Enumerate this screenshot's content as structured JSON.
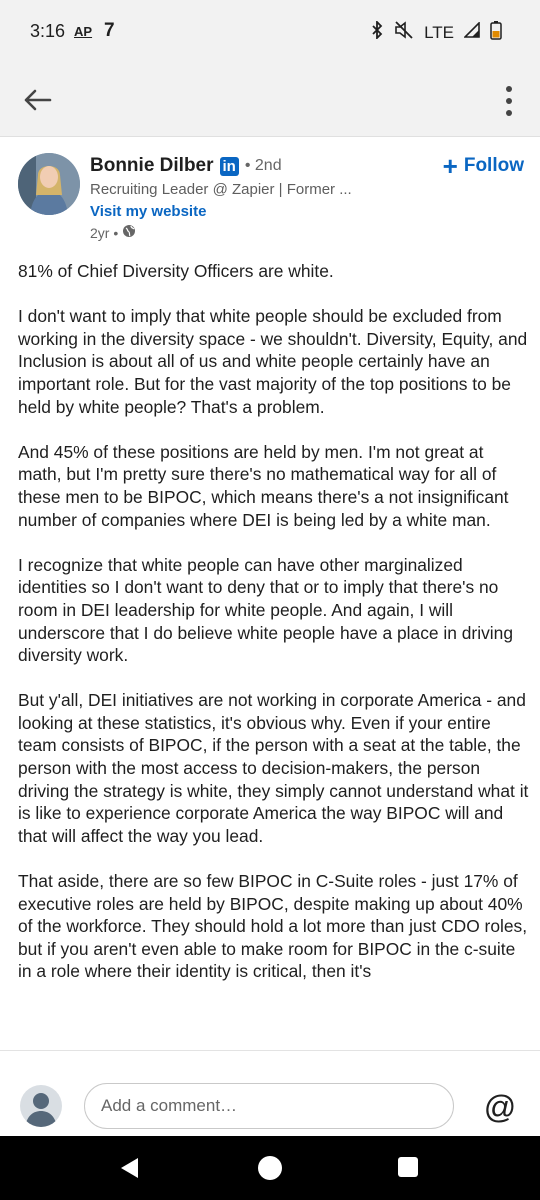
{
  "status_bar": {
    "time": "3:16",
    "app_label": "AP",
    "network_label": "LTE"
  },
  "post": {
    "author": {
      "name": "Bonnie Dilber",
      "badge": "in",
      "degree": "• 2nd",
      "headline": "Recruiting Leader @ Zapier | Former ...",
      "website_link": "Visit my website",
      "time": "2yr •"
    },
    "follow_label": "Follow",
    "paragraphs": [
      "81% of Chief Diversity Officers are white.",
      "I don't want to imply that white people should be excluded from working in the diversity space - we shouldn't. Diversity, Equity, and Inclusion is about all of us and white people certainly have an important role. But for the vast majority of the top positions to be held by white people? That's a problem.",
      "And 45% of these positions are held by men. I'm not great at math, but I'm pretty sure there's no mathematical way for all of these men to be BIPOC, which means there's a not insignificant number of companies where DEI is being led by a white man.",
      "I recognize that white people can have other marginalized identities so I don't want to deny that or to imply that there's no room in DEI leadership for white people. And again, I will underscore that I do believe white people have a place in driving diversity work.",
      "But y'all, DEI initiatives are not working in corporate America - and looking at these statistics, it's obvious why. Even if your entire team consists of BIPOC, if the person with a seat at the table, the person with the most access to decision-makers, the person driving the strategy is white, they simply cannot understand what it is like to experience corporate America the way BIPOC will and that will affect the way you lead.",
      "That aside, there are so few BIPOC in C-Suite roles - just 17% of executive roles are held by BIPOC, despite making up about 40% of the workforce. They should hold a lot more than just CDO roles, but if you aren't even able to make room for BIPOC in the c-suite in a role where their identity is critical, then it's"
    ]
  },
  "comment_bar": {
    "placeholder": "Add a comment…",
    "mention_symbol": "@"
  },
  "icons": {
    "back": "arrow-left-icon",
    "more": "more-vertical-icon",
    "visibility": "globe-icon"
  },
  "colors": {
    "accent": "#0a66c2",
    "text": "#1f1f1f",
    "muted": "#666666"
  }
}
